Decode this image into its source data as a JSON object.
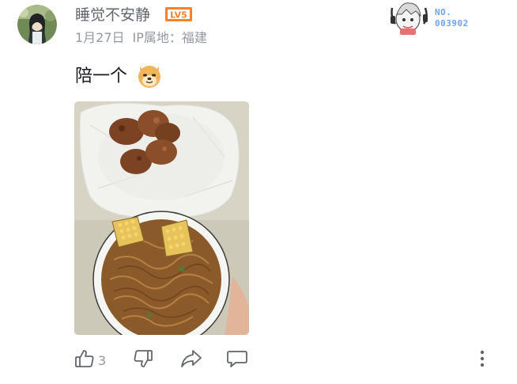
{
  "comment": {
    "username": "睡觉不安静",
    "level": "LV5",
    "date": "1月27日",
    "ip_location": "IP属地：福建",
    "text": "陪一个",
    "fan_badge": {
      "prefix": "NO.",
      "number": "003902"
    },
    "like_count": "3"
  },
  "colors": {
    "level_badge": "#f5822a",
    "fan_badge_text": "#6fa3ea",
    "meta_text": "#9499a0",
    "icon_stroke": "#61666d"
  },
  "icons": [
    "thumbs-up-icon",
    "thumbs-down-icon",
    "share-icon",
    "reply-icon",
    "more-options-icon"
  ]
}
